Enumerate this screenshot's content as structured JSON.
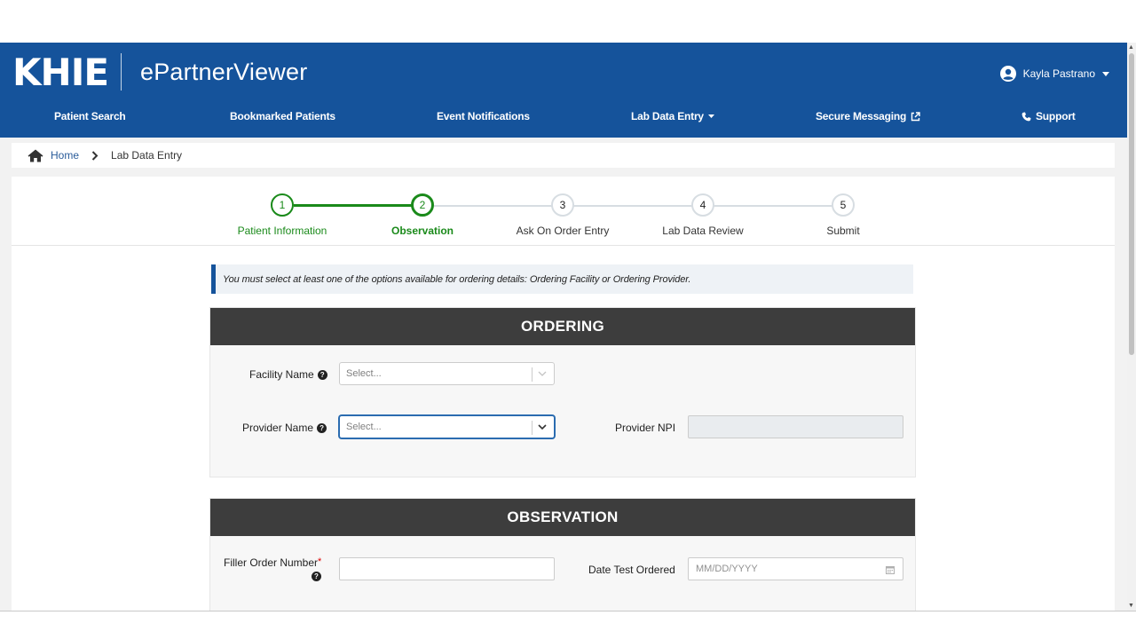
{
  "header": {
    "logo": "KHIE",
    "app_name": "ePartnerViewer",
    "user_name": "Kayla Pastrano"
  },
  "nav": {
    "items": [
      {
        "label": "Patient Search"
      },
      {
        "label": "Bookmarked Patients"
      },
      {
        "label": "Event Notifications"
      },
      {
        "label": "Lab Data Entry"
      },
      {
        "label": "Secure Messaging"
      },
      {
        "label": "Support"
      }
    ]
  },
  "breadcrumb": {
    "home": "Home",
    "current": "Lab Data Entry"
  },
  "stepper": {
    "steps": [
      {
        "number": "1",
        "label": "Patient Information",
        "state": "done"
      },
      {
        "number": "2",
        "label": "Observation",
        "state": "active"
      },
      {
        "number": "3",
        "label": "Ask On Order Entry",
        "state": "todo"
      },
      {
        "number": "4",
        "label": "Lab Data Review",
        "state": "todo"
      },
      {
        "number": "5",
        "label": "Submit",
        "state": "todo"
      }
    ]
  },
  "alert": {
    "text": "You must select at least one of the options available for ordering details: Ordering Facility or Ordering Provider."
  },
  "ordering": {
    "title": "ORDERING",
    "facility_label": "Facility Name",
    "facility_placeholder": "Select...",
    "provider_label": "Provider Name",
    "provider_placeholder": "Select...",
    "npi_label": "Provider NPI",
    "npi_value": ""
  },
  "observation": {
    "title": "OBSERVATION",
    "filler_label": "Filler Order Number",
    "filler_required": "*",
    "filler_value": "",
    "date_label": "Date Test Ordered",
    "date_placeholder": "MM/DD/YYYY"
  },
  "colors": {
    "brand_blue": "#15539b",
    "success_green": "#1a8a1a",
    "section_header": "#3d3d3d"
  }
}
